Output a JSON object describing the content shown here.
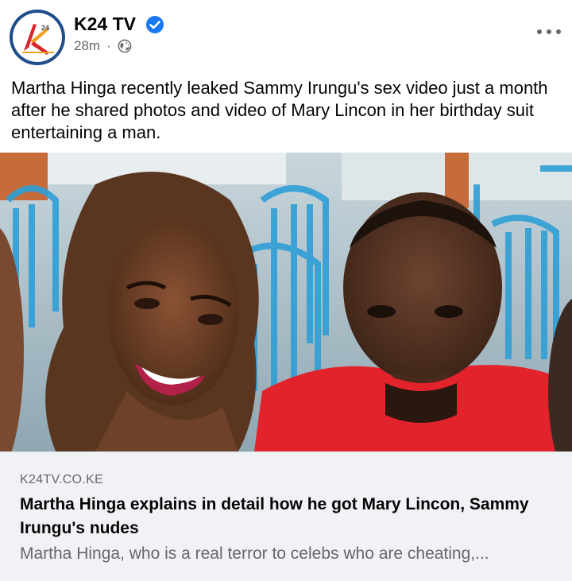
{
  "post": {
    "page_name": "K24 TV",
    "time": "28m",
    "separator": "·",
    "audience_icon": "globe-icon",
    "verified_icon": "verified-badge-icon",
    "menu_icon": "more-options-icon",
    "text": "Martha Hinga recently leaked Sammy Irungu's sex video just a month after he shared photos and video of Mary Lincon in her birthday suit entertaining a man."
  },
  "link_card": {
    "domain": "K24TV.CO.KE",
    "title": "Martha Hinga explains in detail how he got Mary Lincon, Sammy Irungu's nudes",
    "description": "Martha Hinga, who is a real terror to celebs who are cheating,..."
  },
  "colors": {
    "brand_ring": "#1f4e8c",
    "verified_blue": "#1877f2",
    "secondary_text": "#65676b",
    "card_background": "#f0f2f5"
  }
}
